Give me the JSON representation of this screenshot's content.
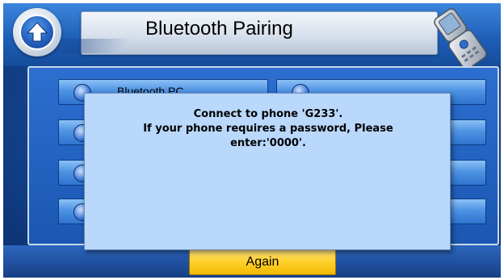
{
  "header": {
    "title": "Bluetooth Pairing",
    "back_icon": "arrow-up-icon",
    "phone_icon": "flip-phone-icon"
  },
  "device_list": {
    "items": [
      {
        "label": "Bluetooth PC"
      },
      {
        "label": ""
      },
      {
        "label": ""
      },
      {
        "label": ""
      },
      {
        "label": ""
      },
      {
        "label": ""
      },
      {
        "label": ""
      },
      {
        "label": ""
      }
    ]
  },
  "dialog": {
    "line1": "Connect to phone 'G233'.",
    "line2": "If your phone requires a password, Please",
    "line3": "enter:'0000'."
  },
  "footer": {
    "again_label": "Again"
  },
  "colors": {
    "accent_blue": "#1e5fb8",
    "dialog_bg": "#b9d8fc",
    "again_yellow": "#ffd02a"
  }
}
